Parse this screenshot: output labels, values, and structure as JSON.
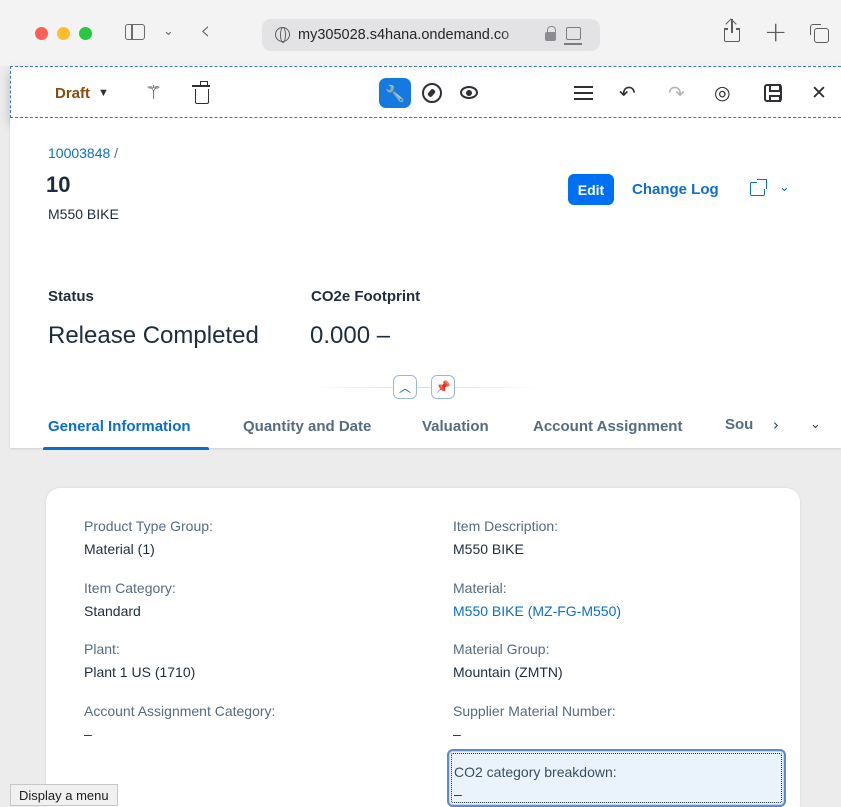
{
  "browser": {
    "url": "my305028.s4hana.ondemand.co",
    "icons": [
      "sidebar-icon",
      "chevron-down-icon",
      "back-icon",
      "globe-icon",
      "lock-icon",
      "pip-icon",
      "share-icon",
      "plus-icon",
      "tabs-icon"
    ]
  },
  "toolbar": {
    "draft_label": "Draft",
    "icons": [
      "magic-wand-icon",
      "trash-icon",
      "wrench-icon",
      "compass-icon",
      "eye-icon",
      "menu-icon",
      "undo-icon",
      "redo-icon",
      "comment-icon",
      "save-icon",
      "close-icon"
    ],
    "accent": "#1679e0"
  },
  "header": {
    "breadcrumb": "10003848",
    "breadcrumb_sep": " /",
    "title": "10",
    "subtitle": "M550 BIKE",
    "edit_label": "Edit",
    "changelog_label": "Change Log"
  },
  "kpis": {
    "status_label": "Status",
    "status_value": "Release Completed",
    "co2_label": "CO2e Footprint",
    "co2_value": "0.000  –"
  },
  "tabs": {
    "items": [
      "General Information",
      "Quantity and Date",
      "Valuation",
      "Account Assignment"
    ],
    "more": "Sou",
    "active_index": 0
  },
  "fields": {
    "product_type_group": {
      "label": "Product Type Group:",
      "value": "Material (1)"
    },
    "item_category": {
      "label": "Item Category:",
      "value": "Standard"
    },
    "plant": {
      "label": "Plant:",
      "value": "Plant 1 US (1710)"
    },
    "account_assignment_category": {
      "label": "Account Assignment Category:",
      "value": "–"
    },
    "item_description": {
      "label": "Item Description:",
      "value": "M550 BIKE"
    },
    "material": {
      "label": "Material:",
      "value": "M550 BIKE (MZ-FG-M550)"
    },
    "material_group": {
      "label": "Material Group:",
      "value": "Mountain (ZMTN)"
    },
    "supplier_material_number": {
      "label": "Supplier Material Number:",
      "value": "–"
    },
    "co2_category_breakdown": {
      "label": "CO2 category breakdown:",
      "value": "–"
    }
  },
  "tooltip": "Display a menu",
  "colors": {
    "link": "#0a6ed1",
    "primary_button": "#0070f2",
    "draft": "#8b4a10"
  }
}
